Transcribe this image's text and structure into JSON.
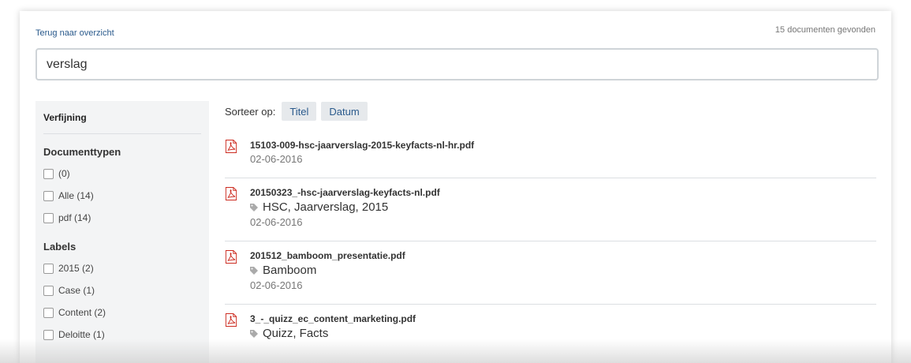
{
  "header": {
    "back_link": "Terug naar overzicht",
    "result_count": "15 documenten gevonden"
  },
  "search": {
    "value": "verslag"
  },
  "sidebar": {
    "title": "Verfijning",
    "groups": [
      {
        "title": "Documenttypen",
        "options": [
          "(0)",
          "Alle (14)",
          "pdf (14)"
        ]
      },
      {
        "title": "Labels",
        "options": [
          "2015 (2)",
          "Case (1)",
          "Content (2)",
          "Deloitte (1)"
        ]
      }
    ]
  },
  "sort": {
    "label": "Sorteer op:",
    "title_button": "Titel",
    "date_button": "Datum"
  },
  "results": [
    {
      "filename": "15103-009-hsc-jaarverslag-2015-keyfacts-nl-hr.pdf",
      "tags": "",
      "date": "02-06-2016"
    },
    {
      "filename": "20150323_-hsc-jaarverslag-keyfacts-nl.pdf",
      "tags": "HSC, Jaarverslag, 2015",
      "date": "02-06-2016"
    },
    {
      "filename": "201512_bamboom_presentatie.pdf",
      "tags": "Bamboom",
      "date": "02-06-2016"
    },
    {
      "filename": "3_-_quizz_ec_content_marketing.pdf",
      "tags": "Quizz, Facts",
      "date": ""
    }
  ],
  "icons": {
    "file": "pdf-file-icon",
    "tag": "tag-icon",
    "pdf_color": "#cc2a1f"
  }
}
